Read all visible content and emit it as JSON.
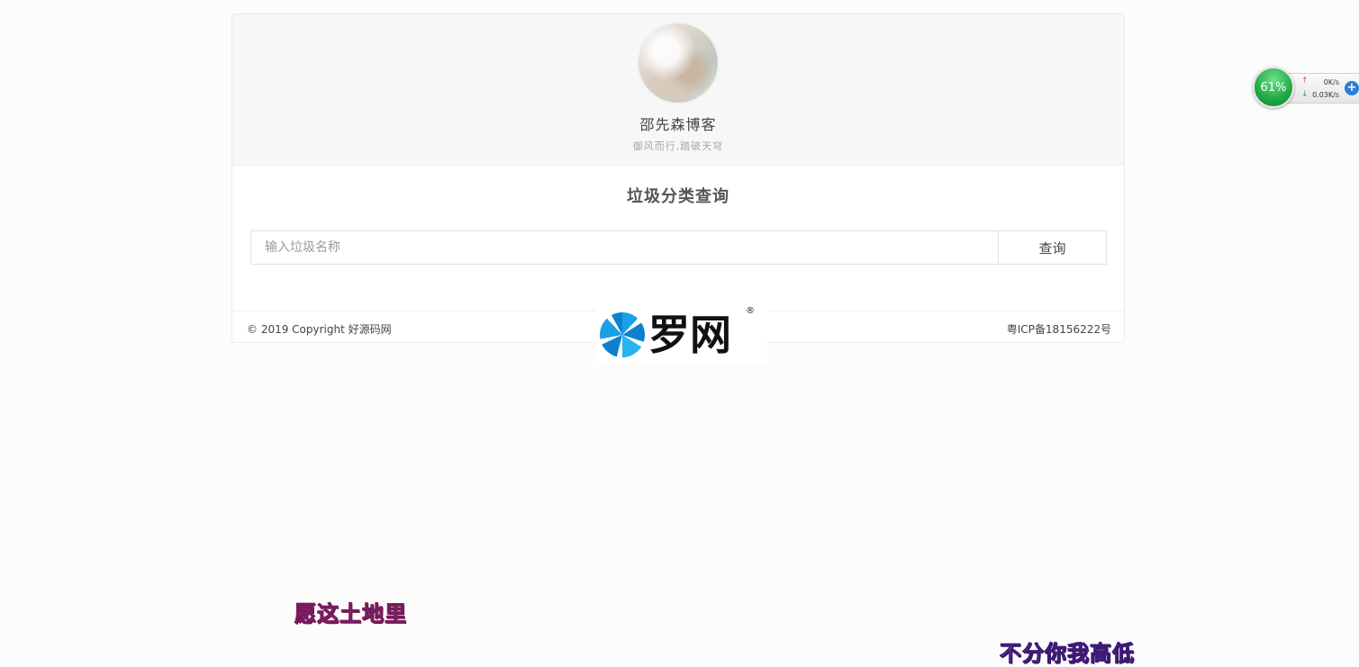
{
  "profile": {
    "name": "邵先森博客",
    "motto": "御风而行,踏破天穹"
  },
  "query": {
    "title": "垃圾分类查询",
    "input_placeholder": "输入垃圾名称",
    "button_label": "查询"
  },
  "footer": {
    "copyright": "© 2019 Copyright 好源码网",
    "icp": "粤ICP备18156222号"
  },
  "watermark": {
    "text": "罗网",
    "registered": "®"
  },
  "speed_widget": {
    "percent": "61%",
    "up_rate": "0K/s",
    "down_rate": "0.03K/s",
    "plus": "+"
  },
  "subtitles": {
    "left": "愿这土地里",
    "right": "不分你我高低"
  },
  "colors": {
    "background": "#fdfcfd",
    "profile_bg": "#f7f7f7",
    "speed_green": "#1fa845",
    "watermark_blue": "#1aa0e8"
  }
}
